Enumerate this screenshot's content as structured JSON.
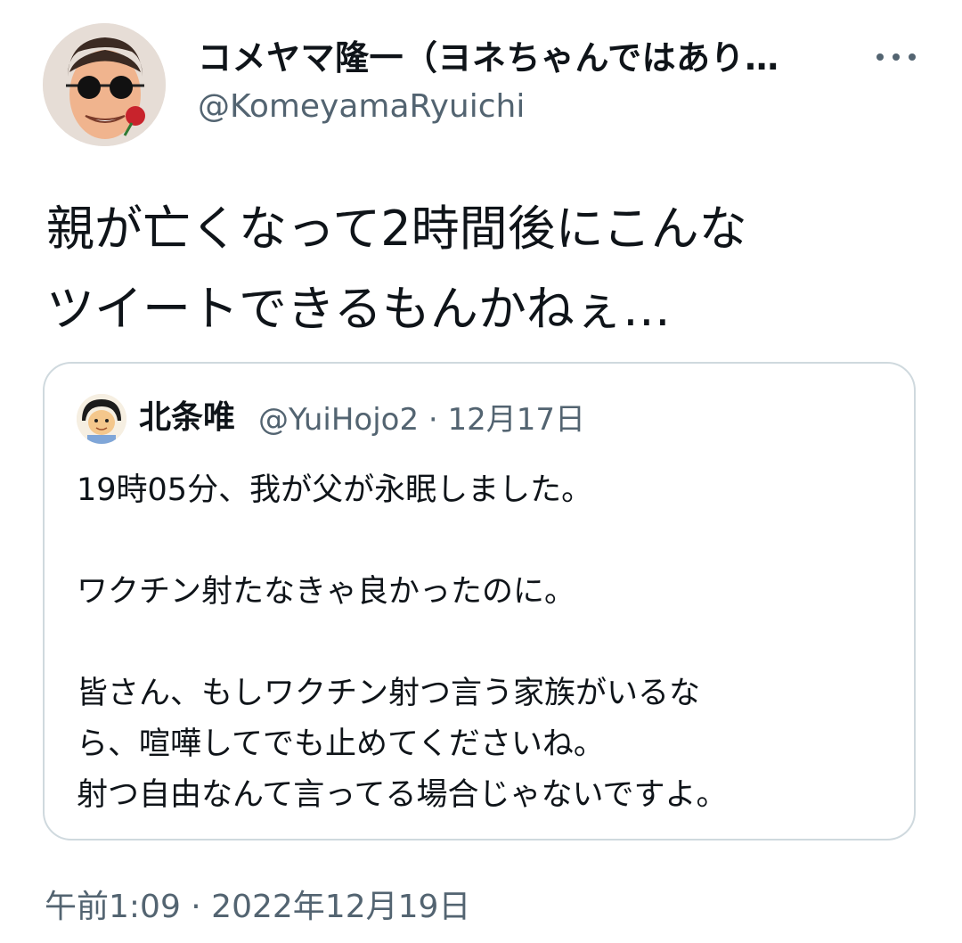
{
  "tweet": {
    "author": {
      "display_name": "コメヤマ隆一（ヨネちゃんではあり…",
      "handle": "@KomeyamaRyuichi",
      "avatar_icon": "caricature-avatar-icon"
    },
    "more_icon": "more-horizontal-icon",
    "text_lines": [
      "親が亡くなって2時間後にこんな",
      "ツイートできるもんかねぇ…"
    ],
    "quoted": {
      "author_name": "北条唯",
      "handle_and_date": "@YuiHojo2 · 12月17日",
      "avatar_icon": "cartoon-avatar-icon",
      "body_lines": [
        "19時05分、我が父が永眠しました。",
        "",
        "ワクチン射たなきゃ良かったのに。",
        "",
        "皆さん、もしワクチン射つ言う家族がいるな",
        "ら、喧嘩してでも止めてくださいね。",
        "射つ自由なんて言ってる場合じゃないですよ。"
      ]
    },
    "timestamp": "午前1:09 · 2022年12月19日"
  },
  "colors": {
    "text": "#0f1419",
    "secondary": "#536471",
    "border": "#cfd9de"
  }
}
